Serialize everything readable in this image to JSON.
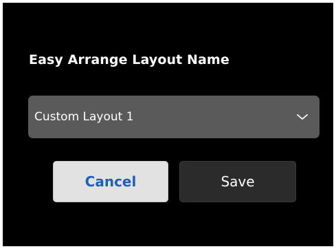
{
  "dialog": {
    "title": "Easy Arrange Layout Name",
    "layout_select": {
      "value": "Custom Layout 1",
      "icon": "chevron-down-icon"
    },
    "buttons": {
      "cancel_label": "Cancel",
      "save_label": "Save"
    }
  },
  "colors": {
    "background": "#000000",
    "select_background": "#5a5a5a",
    "cancel_background": "#e2e2e2",
    "cancel_text": "#1f5fb4",
    "save_background": "#2b2b2b"
  }
}
